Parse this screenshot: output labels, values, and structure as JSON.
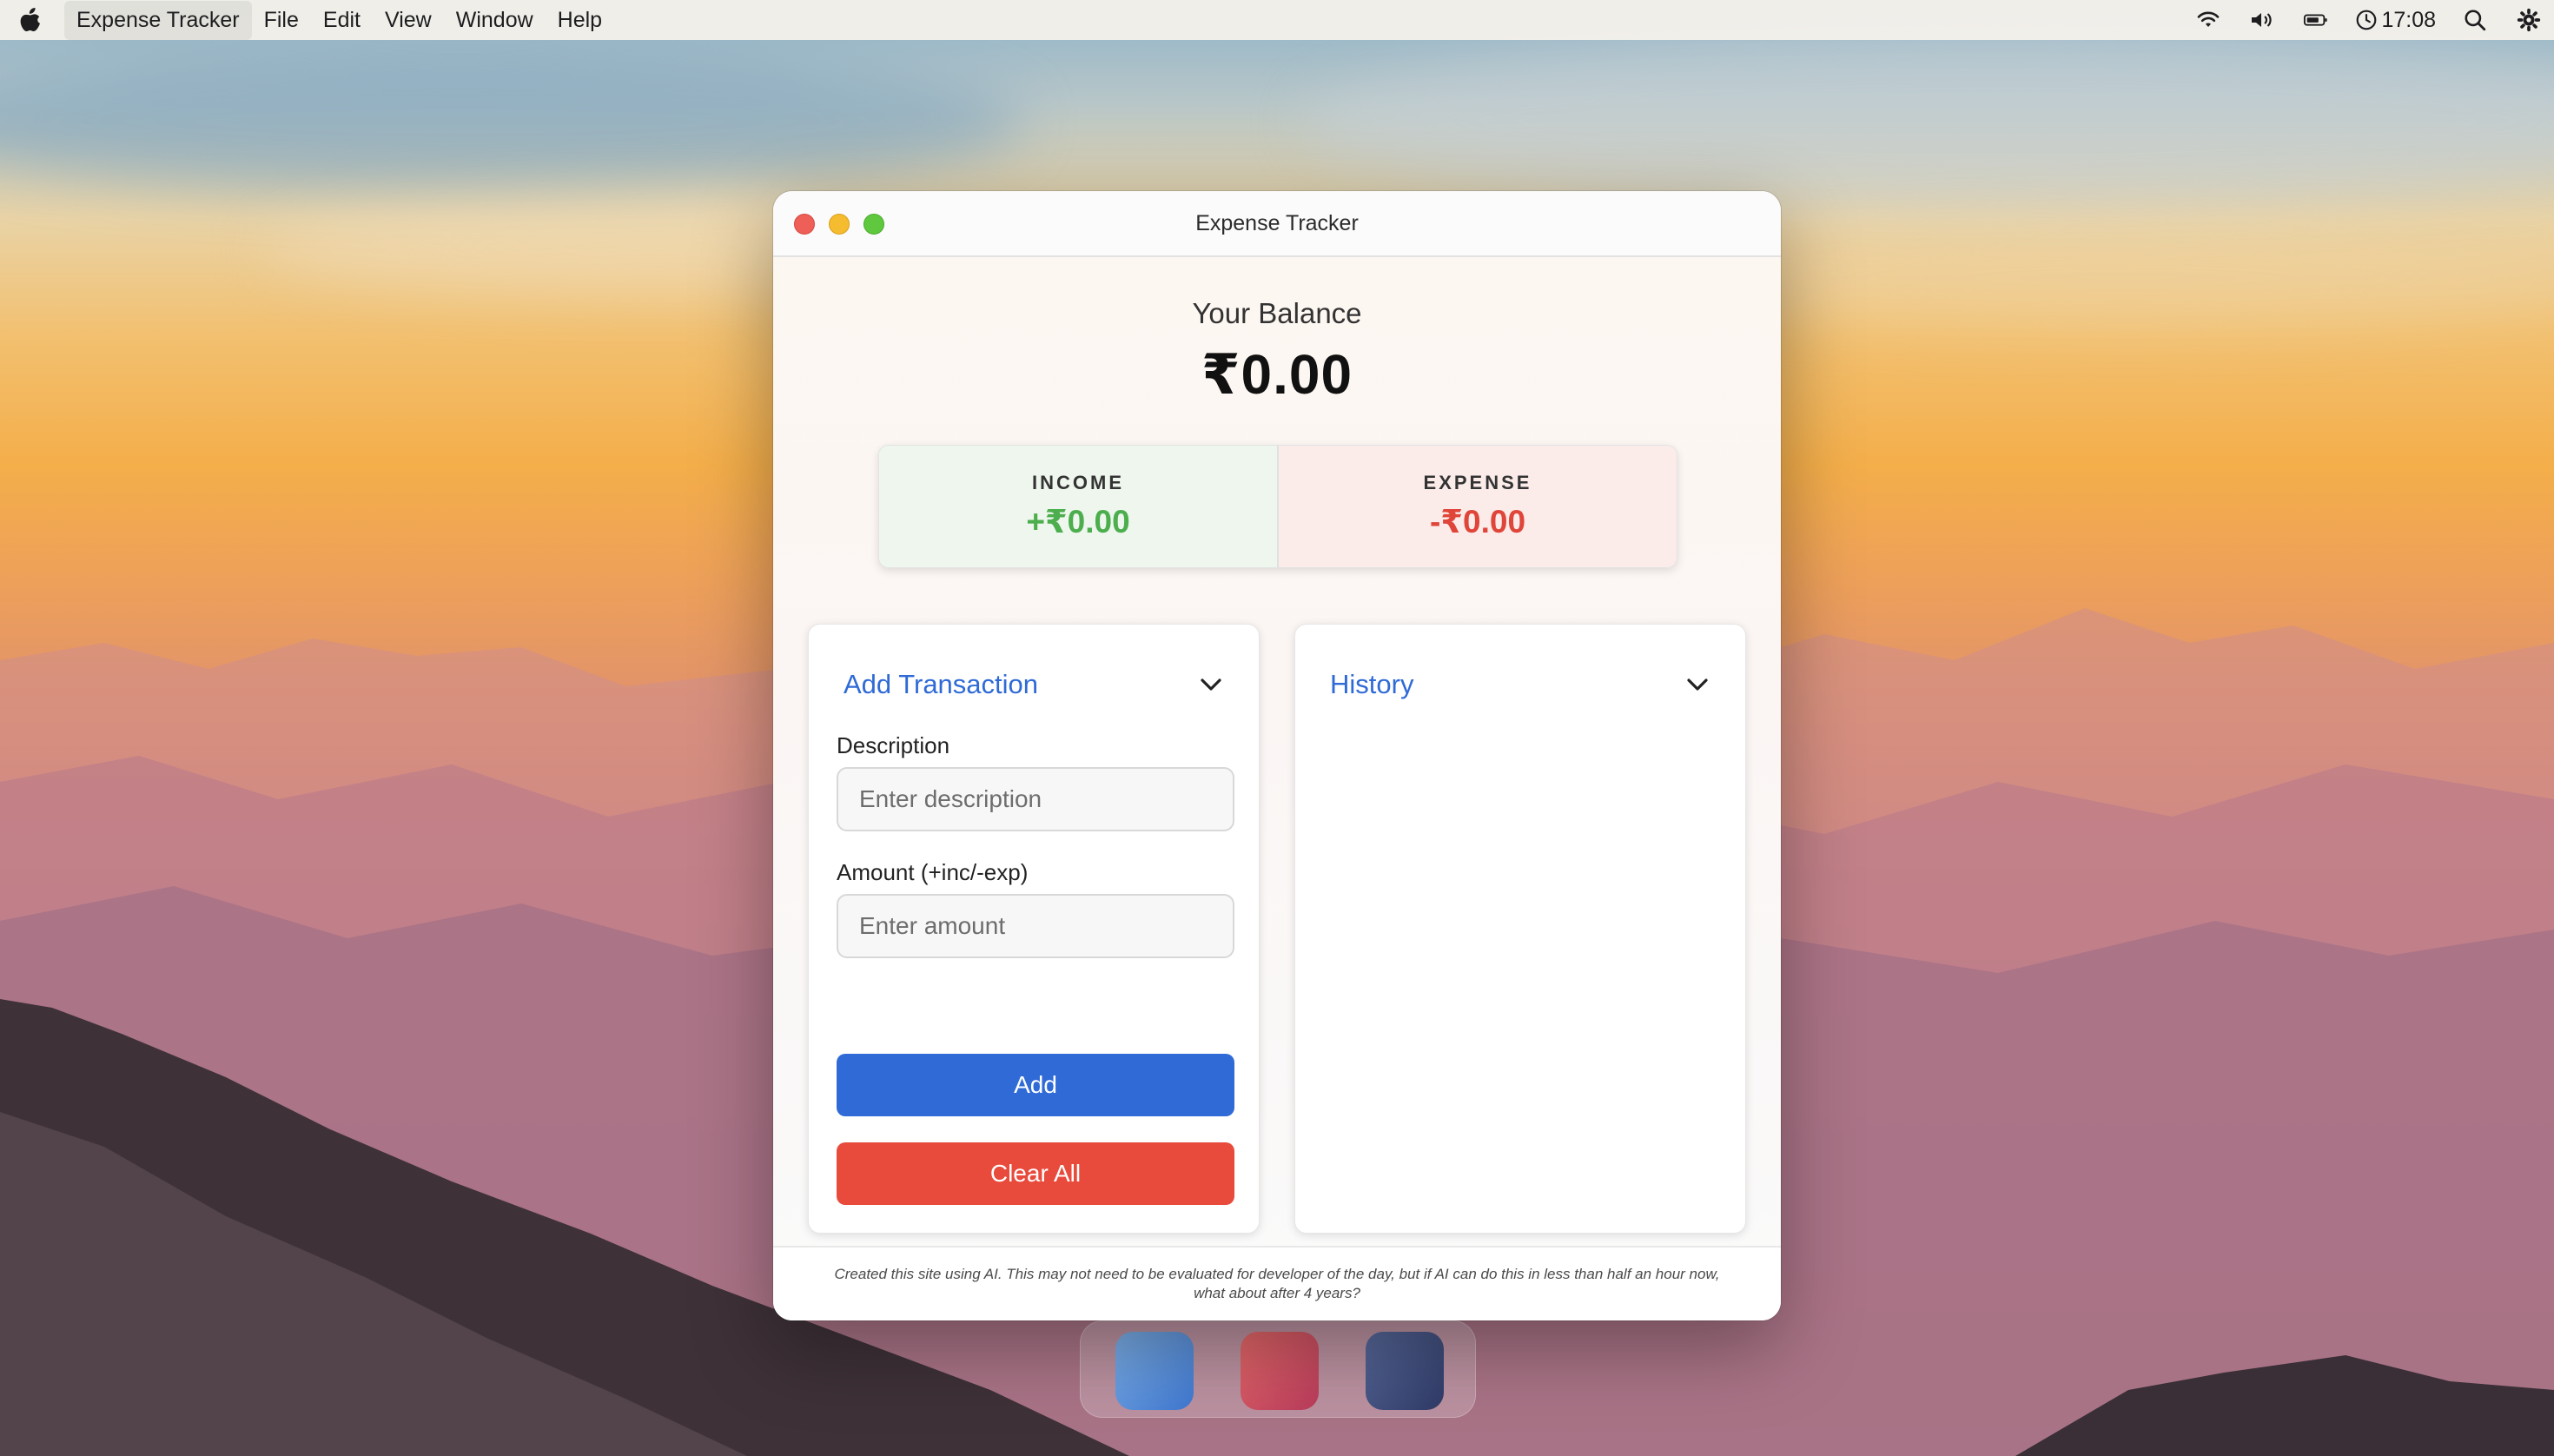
{
  "menubar": {
    "app_name": "Expense Tracker",
    "menus": [
      "File",
      "Edit",
      "View",
      "Window",
      "Help"
    ],
    "time": "17:08",
    "status_icons": [
      "wifi-icon",
      "volume-icon",
      "battery-icon",
      "clock-icon",
      "search-icon",
      "control-center-icon"
    ]
  },
  "window": {
    "title": "Expense Tracker"
  },
  "balance": {
    "label": "Your Balance",
    "value": "₹0.00"
  },
  "summary": {
    "income_label": "INCOME",
    "income_value": "+₹0.00",
    "expense_label": "EXPENSE",
    "expense_value": "-₹0.00",
    "income_color": "#4cae4c",
    "expense_color": "#e0453a"
  },
  "add_transaction": {
    "title": "Add Transaction",
    "description_label": "Description",
    "description_placeholder": "Enter description",
    "amount_label": "Amount (+inc/-exp)",
    "amount_placeholder": "Enter amount",
    "add_label": "Add",
    "clear_label": "Clear All",
    "accent_color": "#2f6ad6",
    "danger_color": "#e84a3b"
  },
  "history": {
    "title": "History",
    "items": []
  },
  "footer": {
    "text": "Created this site using AI. This may not need to be evaluated for developer of the day, but if AI can do this in less than half an hour now, what about after 4 years?"
  }
}
